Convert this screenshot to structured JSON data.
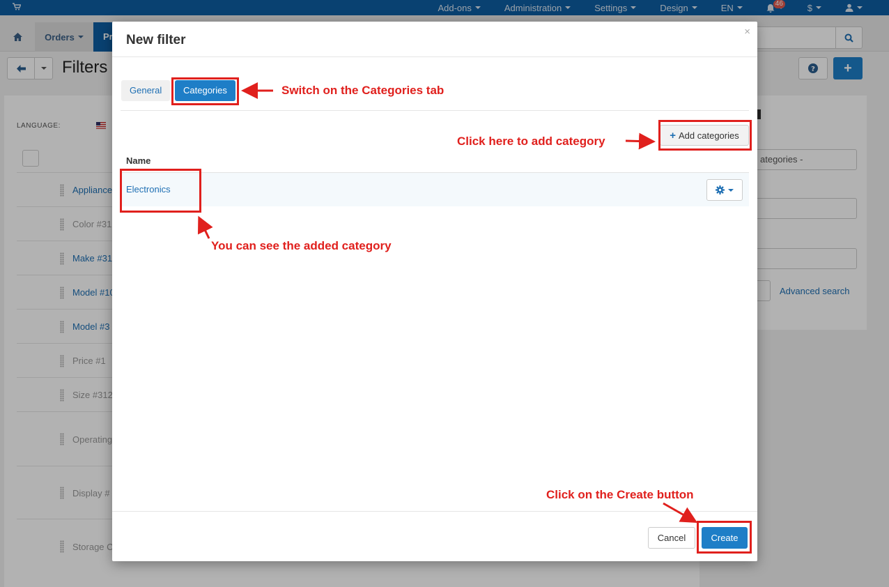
{
  "topbar": {
    "menu": [
      {
        "label": "Add-ons",
        "dropdown": true
      },
      {
        "label": "Administration",
        "dropdown": true
      },
      {
        "label": "Settings",
        "dropdown": true
      },
      {
        "label": "Design",
        "dropdown": true
      },
      {
        "label": "EN",
        "dropdown": true
      }
    ],
    "notifications_count": "46",
    "currency": "$"
  },
  "nav": {
    "orders_label": "Orders",
    "products_label": "Pr"
  },
  "page": {
    "title": "Filters",
    "language_label": "LANGUAGE:"
  },
  "filters_list": [
    {
      "label": "Appliance",
      "style": "link"
    },
    {
      "label": "Color #31",
      "style": "muted"
    },
    {
      "label": "Make #31",
      "style": "link"
    },
    {
      "label": "Model #10",
      "style": "link"
    },
    {
      "label": "Model #3",
      "style": "link"
    },
    {
      "label": "Price #1",
      "style": "muted"
    },
    {
      "label": "Size #312",
      "style": "muted"
    },
    {
      "label": "Operating",
      "style": "muted"
    },
    {
      "label": "Display #",
      "style": "muted"
    },
    {
      "label": "Storage C",
      "style": "muted"
    }
  ],
  "side_panel": {
    "select_value": "ategories -",
    "advanced_search": "Advanced search"
  },
  "modal": {
    "title": "New filter",
    "close_glyph": "×",
    "tabs": {
      "general": "General",
      "categories": "Categories"
    },
    "add_categories_label": "Add categories",
    "table": {
      "header_name": "Name",
      "rows": [
        {
          "name": "Electronics"
        }
      ]
    },
    "footer": {
      "cancel": "Cancel",
      "create": "Create"
    }
  },
  "annotations": {
    "switch_tab": "Switch on the Categories tab",
    "add_category": "Click here to add category",
    "added_category": "You can see the added category",
    "create_button": "Click on the Create button"
  },
  "colors": {
    "accent": "#1e7ec7",
    "topbar": "#0e5da2",
    "annotation": "#e0201d",
    "link": "#1e6fb3"
  }
}
